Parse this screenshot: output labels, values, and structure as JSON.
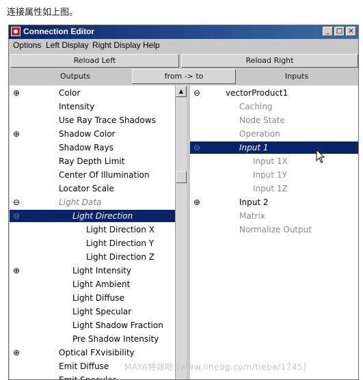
{
  "caption": "连接属性如上图。",
  "window": {
    "title": "Connection Editor",
    "controls": {
      "minimize": "_",
      "maximize": "□",
      "close": "×"
    }
  },
  "menu": [
    "Options",
    "Left Display",
    "Right Display",
    "Help"
  ],
  "buttons": {
    "reload_left": "Reload Left",
    "reload_right": "Reload Right",
    "from_to": "from -> to"
  },
  "headers": {
    "outputs": "Outputs",
    "inputs": "Inputs"
  },
  "scroll_up_glyph": "▲",
  "left_list": [
    {
      "label": "Color",
      "indent": 1,
      "expander": "plus",
      "color": "#000000"
    },
    {
      "label": "Intensity",
      "indent": 1,
      "expander": "",
      "color": "#000000"
    },
    {
      "label": "Use Ray Trace Shadows",
      "indent": 1,
      "expander": "",
      "color": "#000000"
    },
    {
      "label": "Shadow Color",
      "indent": 1,
      "expander": "plus",
      "color": "#000000"
    },
    {
      "label": "Shadow Rays",
      "indent": 1,
      "expander": "",
      "color": "#000000"
    },
    {
      "label": "Ray Depth Limit",
      "indent": 1,
      "expander": "",
      "color": "#000000"
    },
    {
      "label": "Center Of Illumination",
      "indent": 1,
      "expander": "",
      "color": "#000000"
    },
    {
      "label": "Locator Scale",
      "indent": 1,
      "expander": "",
      "color": "#000000"
    },
    {
      "label": "Light Data",
      "indent": 1,
      "expander": "minus",
      "color": "#808080",
      "italic": true
    },
    {
      "label": "Light Direction",
      "indent": 2,
      "expander": "minus",
      "color": "#ffffff",
      "selected": true
    },
    {
      "label": "Light Direction X",
      "indent": 3,
      "expander": "",
      "color": "#000000"
    },
    {
      "label": "Light Direction Y",
      "indent": 3,
      "expander": "",
      "color": "#000000"
    },
    {
      "label": "Light Direction Z",
      "indent": 3,
      "expander": "",
      "color": "#000000"
    },
    {
      "label": "Light Intensity",
      "indent": 2,
      "expander": "plus",
      "color": "#000000"
    },
    {
      "label": "Light Ambient",
      "indent": 2,
      "expander": "",
      "color": "#000000"
    },
    {
      "label": "Light Diffuse",
      "indent": 2,
      "expander": "",
      "color": "#000000"
    },
    {
      "label": "Light Specular",
      "indent": 2,
      "expander": "",
      "color": "#000000"
    },
    {
      "label": "Light Shadow Fraction",
      "indent": 2,
      "expander": "",
      "color": "#000000"
    },
    {
      "label": "Pre Shadow Intensity",
      "indent": 2,
      "expander": "",
      "color": "#000000"
    },
    {
      "label": "Optical FXvisibility",
      "indent": 1,
      "expander": "plus",
      "color": "#000000"
    },
    {
      "label": "Emit Diffuse",
      "indent": 1,
      "expander": "",
      "color": "#000000"
    },
    {
      "label": "Emit Specular",
      "indent": 1,
      "expander": "",
      "color": "#000000"
    }
  ],
  "right_list": [
    {
      "label": "vectorProduct1",
      "indent": 0,
      "expander": "minus",
      "color": "#000000"
    },
    {
      "label": "Caching",
      "indent": 1,
      "expander": "",
      "color": "#8a8a8a"
    },
    {
      "label": "Node State",
      "indent": 1,
      "expander": "",
      "color": "#8a8a8a"
    },
    {
      "label": "Operation",
      "indent": 1,
      "expander": "",
      "color": "#8a8a8a"
    },
    {
      "label": "Input 1",
      "indent": 1,
      "expander": "minus",
      "color": "#ffffff",
      "selected": true
    },
    {
      "label": "Input 1X",
      "indent": 2,
      "expander": "",
      "color": "#8a8a8a"
    },
    {
      "label": "Input 1Y",
      "indent": 2,
      "expander": "",
      "color": "#8a8a8a"
    },
    {
      "label": "Input 1Z",
      "indent": 2,
      "expander": "",
      "color": "#8a8a8a"
    },
    {
      "label": "Input 2",
      "indent": 1,
      "expander": "plus",
      "color": "#000000"
    },
    {
      "label": "Matrix",
      "indent": 1,
      "expander": "",
      "color": "#8a8a8a"
    },
    {
      "label": "Normalize Output",
      "indent": 1,
      "expander": "",
      "color": "#8a8a8a"
    }
  ],
  "watermark": "MAYA特效吧 [www.lineog.com/tieba/1745]",
  "colors": {
    "selection": "#0a246a",
    "window_bg": "#c8c8c8",
    "title_gradient_start": "#0a246a"
  }
}
